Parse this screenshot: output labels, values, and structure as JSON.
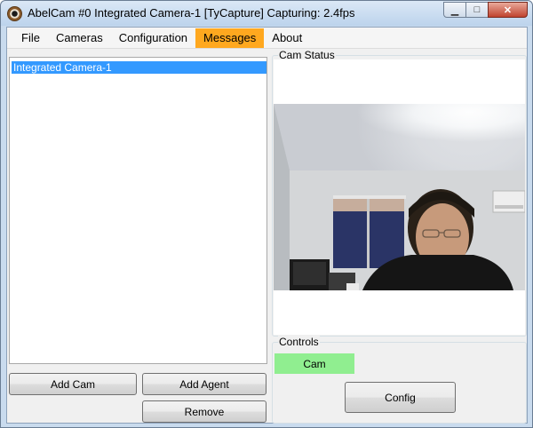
{
  "window": {
    "title": "AbelCam #0 Integrated Camera-1 [TyCapture]  Capturing:  2.4fps",
    "minimize_glyph": "▁",
    "maximize_glyph": "□",
    "close_glyph": "✕"
  },
  "menu": {
    "items": [
      "File",
      "Cameras",
      "Configuration",
      "Messages",
      "About"
    ],
    "active": "Messages",
    "active_color": "#ffa81f"
  },
  "cameras_list": {
    "items": [
      "Integrated Camera-1"
    ],
    "selected_color": "#3399ff"
  },
  "left_buttons": {
    "add_cam": "Add Cam",
    "add_agent": "Add Agent",
    "remove": "Remove"
  },
  "cam_status": {
    "label": "Cam Status"
  },
  "controls": {
    "label": "Controls",
    "cam_toggle": "Cam",
    "cam_toggle_color": "#90ee90",
    "config": "Config"
  }
}
